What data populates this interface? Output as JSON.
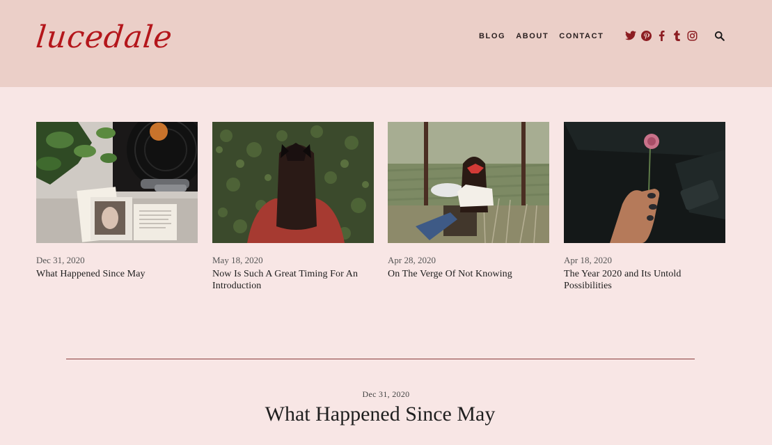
{
  "brand": {
    "logo": "lucedale",
    "accent": "#b4161b"
  },
  "nav": {
    "items": [
      {
        "label": "BLOG"
      },
      {
        "label": "ABOUT"
      },
      {
        "label": "CONTACT"
      }
    ]
  },
  "social": {
    "icons": [
      "twitter-icon",
      "pinterest-icon",
      "facebook-icon",
      "tumblr-icon",
      "instagram-icon"
    ],
    "color": "#8c1d22"
  },
  "search": {
    "icon": "search-icon"
  },
  "posts": [
    {
      "date": "Dec 31, 2020",
      "title": "What Happened Since May",
      "image": "vinyl record player with book and plant"
    },
    {
      "date": "May 18, 2020",
      "title": "Now Is Such A Great Timing For An Introduction",
      "image": "woman with bow in front of ivy wall"
    },
    {
      "date": "Apr 28, 2020",
      "title": "On The Verge Of Not Knowing",
      "image": "woman sitting by rice field"
    },
    {
      "date": "Apr 18, 2020",
      "title": "The Year 2020 and Its Untold Possibilities",
      "image": "hand holding pink flower in car"
    }
  ],
  "featured": {
    "date": "Dec 31, 2020",
    "title": "What Happened Since May"
  },
  "colors": {
    "header_bg": "#ebcfc8",
    "page_bg": "#f8e6e5",
    "divider": "#8a3a3a"
  }
}
